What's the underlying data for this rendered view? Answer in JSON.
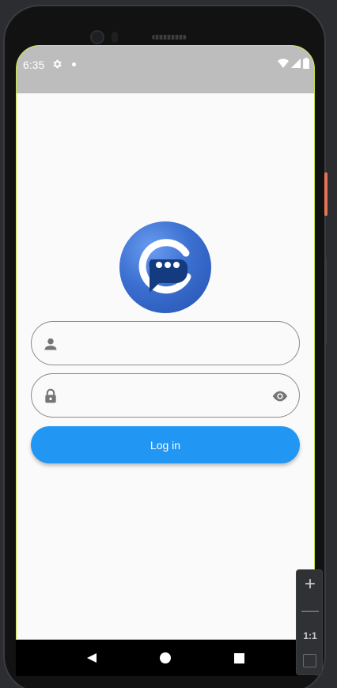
{
  "status_bar": {
    "time": "6:35",
    "icons": [
      "gear-icon",
      "dot-icon",
      "wifi-icon",
      "signal-icon",
      "battery-icon"
    ]
  },
  "login_form": {
    "username_placeholder": "",
    "password_placeholder": "",
    "login_label": "Log in"
  },
  "logo": {
    "icon": "chat-bubble-logo"
  },
  "nav_bar": {
    "items": [
      "back-icon",
      "home-icon",
      "recents-icon"
    ]
  },
  "zoom_controls": {
    "plus": "+",
    "minus": "—",
    "ratio": "1:1"
  },
  "colors": {
    "accent": "#2196f3",
    "status_bar_bg": "#bdbdbd",
    "screen_bg": "#fafafa",
    "logo_blue": "#3b6fd0"
  }
}
